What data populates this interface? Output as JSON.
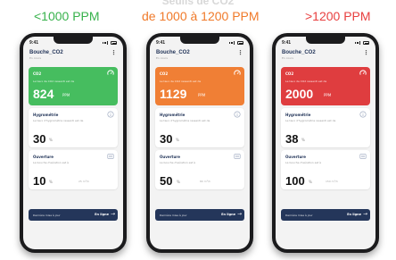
{
  "headings": [
    "<1000 PPM",
    "de 1000 à 1200 PPM",
    ">1200 PPM"
  ],
  "phones": [
    {
      "status_time": "9:41",
      "title": "Bouche_CO2",
      "subtitle": "En cours",
      "co2": {
        "label": "CO2",
        "desc": "Le taux de CO2 ressenti est de",
        "value": "824",
        "unit": "PPM",
        "color": "#46bd5f"
      },
      "hygrometrie": {
        "label": "Hygrométrie",
        "desc": "Le taux d'hygrométrie ressenti est de",
        "value": "30",
        "unit": "%"
      },
      "ouverture": {
        "label": "Ouverture",
        "desc": "La bouche d'aération est à",
        "value": "10",
        "unit": "%",
        "extra": "25 m³/h"
      },
      "bar": {
        "text": "Dernière mise à jour",
        "right": "En ligne"
      }
    },
    {
      "status_time": "9:41",
      "title": "Bouche_CO2",
      "subtitle": "En cours",
      "co2": {
        "label": "CO2",
        "desc": "Le taux de CO2 ressenti est de",
        "value": "1129",
        "unit": "PPM",
        "color": "#f07f35"
      },
      "hygrometrie": {
        "label": "Hygrométrie",
        "desc": "Le taux d'hygrométrie ressenti est de",
        "value": "30",
        "unit": "%"
      },
      "ouverture": {
        "label": "Ouverture",
        "desc": "La bouche d'aération est à",
        "value": "50",
        "unit": "%",
        "extra": "80 m³/h"
      },
      "bar": {
        "text": "Dernière mise à jour",
        "right": "En ligne"
      }
    },
    {
      "status_time": "9:41",
      "title": "Bouche_CO2",
      "subtitle": "En cours",
      "co2": {
        "label": "CO2",
        "desc": "Le taux de CO2 ressenti est de",
        "value": "2000",
        "unit": "PPM",
        "color": "#df3d3f"
      },
      "hygrometrie": {
        "label": "Hygrométrie",
        "desc": "Le taux d'hygrométrie ressenti est de",
        "value": "38",
        "unit": "%"
      },
      "ouverture": {
        "label": "Ouverture",
        "desc": "La bouche d'aération est à",
        "value": "100",
        "unit": "%",
        "extra": "150 m³/h"
      },
      "bar": {
        "text": "Dernière mise à jour",
        "right": "En ligne"
      }
    }
  ]
}
